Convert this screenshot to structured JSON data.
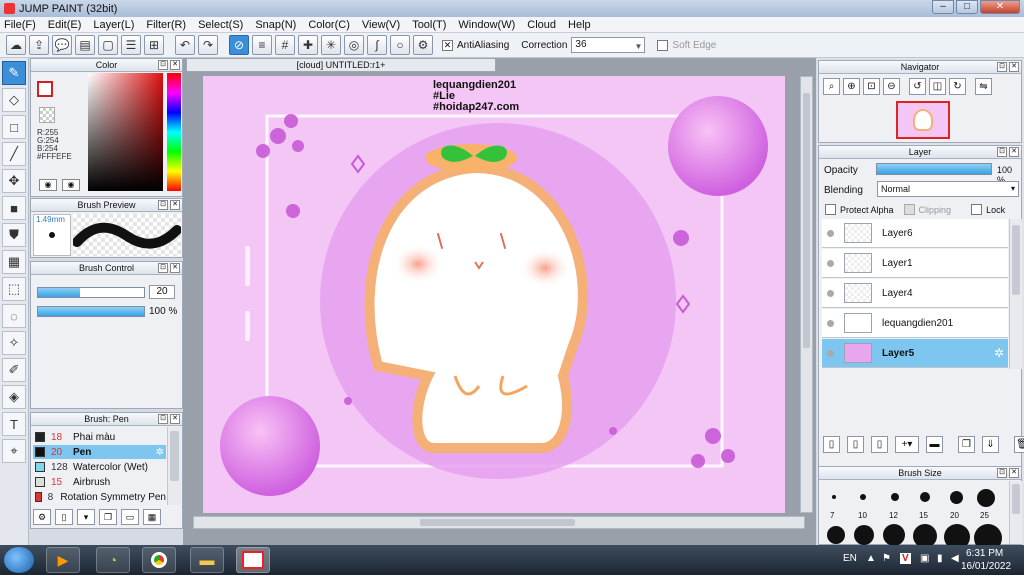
{
  "window": {
    "title": "JUMP PAINT (32bit)",
    "min": "–",
    "max": "□",
    "close": "✕"
  },
  "menu": [
    "File(F)",
    "Edit(E)",
    "Layer(L)",
    "Filter(R)",
    "Select(S)",
    "Snap(N)",
    "Color(C)",
    "View(V)",
    "Tool(T)",
    "Window(W)",
    "Cloud",
    "Help"
  ],
  "toolbar": {
    "antialias_label": "AntiAliasing",
    "correction_label": "Correction",
    "correction_value": "36",
    "softedge_label": "Soft Edge"
  },
  "color_panel": {
    "title": "Color",
    "r": "R:255",
    "g": "G:254",
    "b": "B:254",
    "hex": "#FFFEFE"
  },
  "brush_preview": {
    "title": "Brush Preview",
    "size": "1.49mm"
  },
  "brush_control": {
    "title": "Brush Control",
    "size_value": "20",
    "opacity_value": "100 %",
    "size_fill": 0.4,
    "opacity_fill": 1.0
  },
  "brush_list": {
    "title": "Brush: Pen",
    "items": [
      {
        "num": "18",
        "name": "Phai màu",
        "color": "#222222"
      },
      {
        "num": "20",
        "name": "Pen",
        "color": "#111111"
      },
      {
        "num": "128",
        "name": "Watercolor (Wet)",
        "color": "#7fd8f0"
      },
      {
        "num": "15",
        "name": "Airbrush",
        "color": "#dddddd"
      },
      {
        "num": "8",
        "name": "Rotation Symmetry Pen",
        "color": "#e33232"
      }
    ]
  },
  "document": {
    "tab": "[cloud] UNTITLED:r1+",
    "watermark": [
      "lequangdien201",
      "#Lie",
      "#hoidap247.com"
    ]
  },
  "navigator": {
    "title": "Navigator"
  },
  "layer_panel": {
    "title": "Layer",
    "opacity_label": "Opacity",
    "opacity_value": "100 %",
    "opacity_fill": 1.0,
    "blending_label": "Blending",
    "blending_value": "Normal",
    "protect_alpha": "Protect Alpha",
    "clipping": "Clipping",
    "lock": "Lock",
    "layers": [
      "Layer6",
      "Layer1",
      "Layer4",
      "lequangdien201",
      "Layer5"
    ]
  },
  "brush_size": {
    "title": "Brush Size",
    "sizes": [
      "7",
      "10",
      "12",
      "15",
      "20",
      "25"
    ]
  },
  "taskbar": {
    "lang": "EN",
    "time": "6:31 PM",
    "date": "16/01/2022"
  }
}
